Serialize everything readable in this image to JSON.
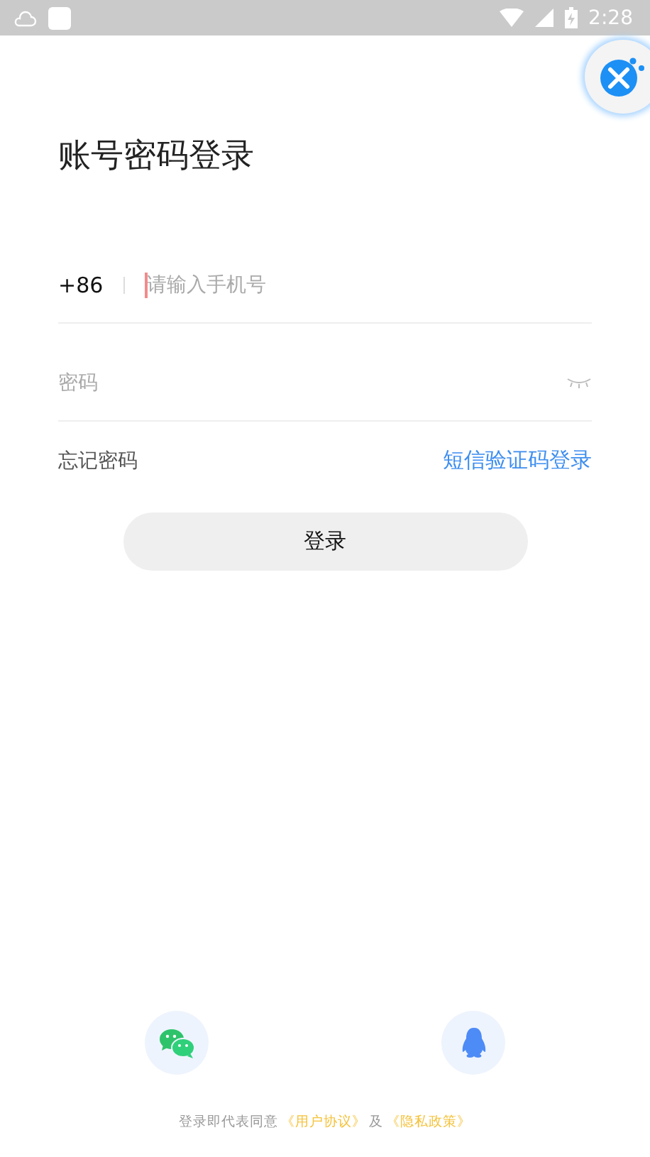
{
  "status_bar": {
    "time": "2:28"
  },
  "title": "账号密码登录",
  "phone_field": {
    "country_code": "+86",
    "placeholder": "请输入手机号"
  },
  "password_field": {
    "placeholder": "密码"
  },
  "forgot_link": "忘记密码",
  "sms_login_link": "短信验证码登录",
  "login_button": "登录",
  "footer": {
    "prefix": "登录即代表同意",
    "agreement_link": "《用户协议》",
    "conjunction": "及",
    "privacy_link": "《隐私政策》"
  }
}
